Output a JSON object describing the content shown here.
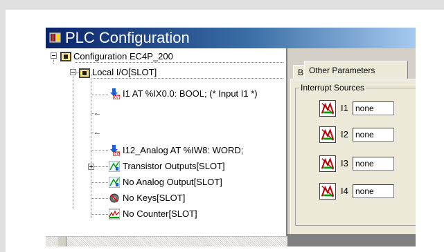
{
  "window": {
    "title": "PLC Configuration"
  },
  "tree": {
    "root_label": "Configuration EC4P_200",
    "local_io_label": "Local I/O[SLOT]",
    "input_label": "I1 AT %IX0.0: BOOL; (* Input I1 *)",
    "ellipsis_1": "...",
    "ellipsis_2": "...",
    "analog_label": "I12_Analog AT %IW8: WORD;",
    "transistor_label": "Transistor Outputs[SLOT]",
    "analog_output_label": "No Analog Output[SLOT]",
    "keys_label": "No Keys[SLOT]",
    "counter_label": "No Counter[SLOT]"
  },
  "tabs": {
    "partial_tab_label": "B",
    "active_tab_label": "Other Parameters"
  },
  "interrupts": {
    "group_title": "Interrupt Sources",
    "rows": [
      {
        "label": "I1",
        "value": "none"
      },
      {
        "label": "I2",
        "value": "none"
      },
      {
        "label": "I3",
        "value": "none"
      },
      {
        "label": "I4",
        "value": "none"
      }
    ]
  }
}
